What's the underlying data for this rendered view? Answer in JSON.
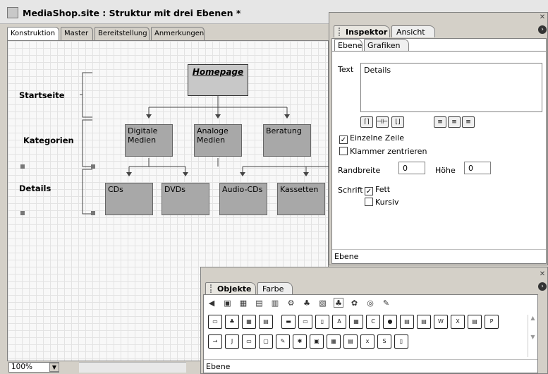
{
  "window": {
    "title": "MediaShop.site : Struktur mit drei Ebenen *"
  },
  "doc_tabs": [
    "Konstruktion",
    "Master",
    "Bereitstellung",
    "Anmerkungen"
  ],
  "levels": {
    "l1": "Startseite",
    "l2": "Kategorien",
    "l3": "Details"
  },
  "nodes": {
    "home": "Homepage",
    "cat1": "Digitale Medien",
    "cat2": "Analoge Medien",
    "cat3": "Beratung",
    "d1": "CDs",
    "d2": "DVDs",
    "d3": "Audio-CDs",
    "d4": "Kassetten"
  },
  "status": {
    "zoom": "100%"
  },
  "inspector": {
    "tabs": {
      "active": "Inspektor",
      "inactive": "Ansicht"
    },
    "subtabs": {
      "s1": "Ebene",
      "s2": "Grafiken"
    },
    "text_label": "Text",
    "text_value": "Details",
    "cb_single_line": "Einzelne Zeile",
    "cb_bracket_center": "Klammer zentrieren",
    "border_width_label": "Randbreite",
    "border_width_value": "0",
    "height_label": "Höhe",
    "height_value": "0",
    "font_label": "Schrift",
    "cb_bold": "Fett",
    "cb_italic": "Kursiv",
    "footer": "Ebene"
  },
  "objects": {
    "tabs": {
      "active": "Objekte",
      "inactive": "Farbe"
    },
    "footer": "Ebene"
  }
}
